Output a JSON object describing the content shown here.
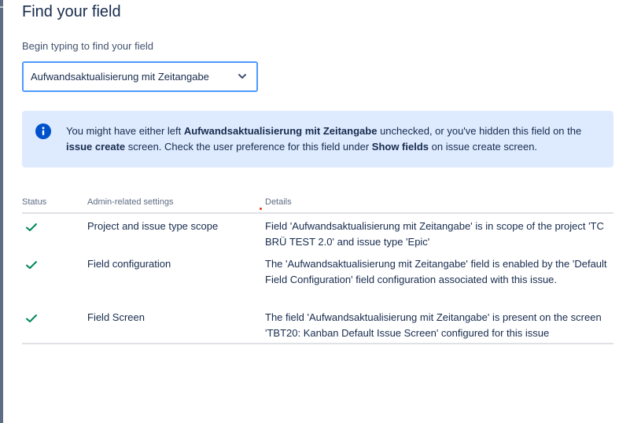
{
  "dialog": {
    "title": "Find your field"
  },
  "search": {
    "label": "Begin typing to find your field",
    "value": "Aufwandsaktualisierung mit Zeitangabe"
  },
  "info_message": {
    "part1": "You might have either left ",
    "field_name": "Aufwandsaktualisierung mit Zeitangabe",
    "part2": " unchecked, or you've hidden this field on the ",
    "screen_name": "issue create",
    "part3": " screen. Check the user preference for this field under ",
    "preference_name": "Show fields",
    "part4": " on issue create screen."
  },
  "table": {
    "headers": {
      "status": "Status",
      "admin": "Admin-related settings",
      "details": "Details"
    },
    "rows": [
      {
        "status": "ok",
        "setting": "Project and issue type scope",
        "details": "Field 'Aufwandsaktualisierung mit Zeitangabe' is in scope of the project 'TC BRÜ TEST 2.0' and issue type 'Epic'"
      },
      {
        "status": "ok",
        "setting": "Field configuration",
        "details": "The 'Aufwandsaktualisierung mit Zeitangabe' field is enabled by the 'Default Field Configuration' field configuration associated with this issue."
      },
      {
        "status": "ok",
        "setting": "Field Screen",
        "details": "The field 'Aufwandsaktualisierung mit Zeitangabe' is present on the screen 'TBT20: Kanban Default Issue Screen' configured for this issue"
      }
    ]
  },
  "colors": {
    "accent": "#0052cc",
    "focus_border": "#4c9aff",
    "info_bg": "#deebff",
    "success": "#00875a",
    "text": "#172b4d",
    "subtle_text": "#5e6c84"
  },
  "icons": {
    "info": "info-icon",
    "chevron": "chevron-down-icon",
    "check": "check-icon"
  }
}
